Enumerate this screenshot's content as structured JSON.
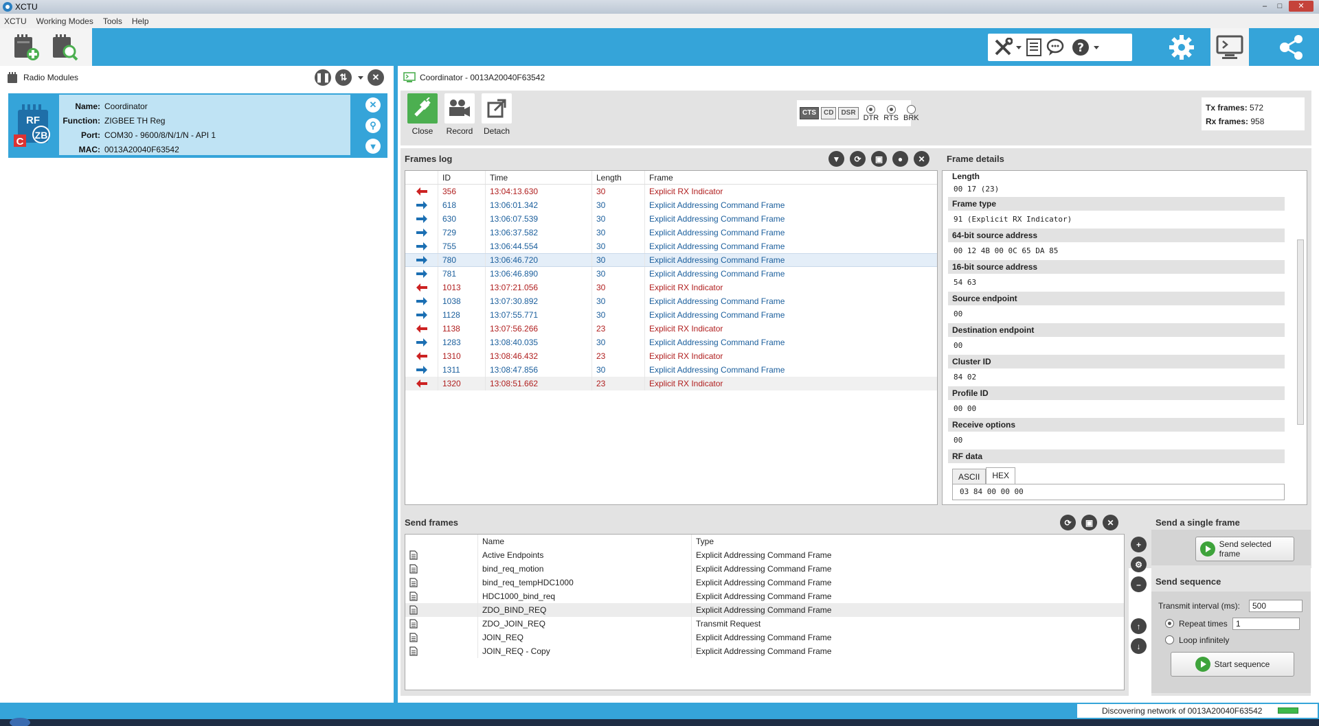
{
  "window": {
    "title": "XCTU"
  },
  "menu": [
    "XCTU",
    "Working Modes",
    "Tools",
    "Help"
  ],
  "left_panel": {
    "title": "Radio Modules",
    "module": {
      "name_label": "Name:",
      "name": "Coordinator",
      "function_label": "Function:",
      "function": "ZIGBEE TH Reg",
      "port_label": "Port:",
      "port": "COM30 - 9600/8/N/1/N - API 1",
      "mac_label": "MAC:",
      "mac": "0013A20040F63542",
      "icon_text_top": "RF",
      "icon_text_zb": "ZB",
      "icon_text_c": "C"
    }
  },
  "console": {
    "title": "Coordinator - 0013A20040F63542",
    "buttons": {
      "close": "Close",
      "record": "Record",
      "detach": "Detach"
    },
    "lines": {
      "cts": "CTS",
      "cd": "CD",
      "dsr": "DSR",
      "dtr": "DTR",
      "rts": "RTS",
      "brk": "BRK"
    },
    "counters": {
      "tx_label": "Tx frames:",
      "tx": "572",
      "rx_label": "Rx frames:",
      "rx": "958"
    }
  },
  "frames_log": {
    "title": "Frames log",
    "details_title": "Frame details",
    "columns": [
      "ID",
      "Time",
      "Length",
      "Frame"
    ],
    "rows": [
      {
        "dir": "rx",
        "id": "356",
        "time": "13:04:13.630",
        "length": "30",
        "frame": "Explicit RX Indicator"
      },
      {
        "dir": "tx",
        "id": "618",
        "time": "13:06:01.342",
        "length": "30",
        "frame": "Explicit Addressing Command Frame"
      },
      {
        "dir": "tx",
        "id": "630",
        "time": "13:06:07.539",
        "length": "30",
        "frame": "Explicit Addressing Command Frame"
      },
      {
        "dir": "tx",
        "id": "729",
        "time": "13:06:37.582",
        "length": "30",
        "frame": "Explicit Addressing Command Frame"
      },
      {
        "dir": "tx",
        "id": "755",
        "time": "13:06:44.554",
        "length": "30",
        "frame": "Explicit Addressing Command Frame"
      },
      {
        "dir": "tx",
        "id": "780",
        "time": "13:06:46.720",
        "length": "30",
        "frame": "Explicit Addressing Command Frame"
      },
      {
        "dir": "tx",
        "id": "781",
        "time": "13:06:46.890",
        "length": "30",
        "frame": "Explicit Addressing Command Frame"
      },
      {
        "dir": "rx",
        "id": "1013",
        "time": "13:07:21.056",
        "length": "30",
        "frame": "Explicit RX Indicator"
      },
      {
        "dir": "tx",
        "id": "1038",
        "time": "13:07:30.892",
        "length": "30",
        "frame": "Explicit Addressing Command Frame"
      },
      {
        "dir": "tx",
        "id": "1128",
        "time": "13:07:55.771",
        "length": "30",
        "frame": "Explicit Addressing Command Frame"
      },
      {
        "dir": "rx",
        "id": "1138",
        "time": "13:07:56.266",
        "length": "23",
        "frame": "Explicit RX Indicator"
      },
      {
        "dir": "tx",
        "id": "1283",
        "time": "13:08:40.035",
        "length": "30",
        "frame": "Explicit Addressing Command Frame"
      },
      {
        "dir": "rx",
        "id": "1310",
        "time": "13:08:46.432",
        "length": "23",
        "frame": "Explicit RX Indicator"
      },
      {
        "dir": "tx",
        "id": "1311",
        "time": "13:08:47.856",
        "length": "30",
        "frame": "Explicit Addressing Command Frame"
      },
      {
        "dir": "rx",
        "id": "1320",
        "time": "13:08:51.662",
        "length": "23",
        "frame": "Explicit RX Indicator"
      }
    ]
  },
  "frame_details": {
    "length_label": "Length",
    "length_value": "00 17 (23)",
    "fields": [
      {
        "label": "Frame type",
        "value": "91 (Explicit RX Indicator)"
      },
      {
        "label": "64-bit source address",
        "value": "00 12 4B 00 0C 65 DA 85"
      },
      {
        "label": "16-bit source address",
        "value": "54 63"
      },
      {
        "label": "Source endpoint",
        "value": "00"
      },
      {
        "label": "Destination endpoint",
        "value": "00"
      },
      {
        "label": "Cluster ID",
        "value": "84 02"
      },
      {
        "label": "Profile ID",
        "value": "00 00"
      },
      {
        "label": "Receive options",
        "value": "00"
      }
    ],
    "rf_label": "RF data",
    "tabs": [
      "ASCII",
      "HEX"
    ],
    "rf_hex": "03 84 00 00 00"
  },
  "send_frames": {
    "title": "Send frames",
    "columns": [
      "Name",
      "Type"
    ],
    "rows": [
      {
        "name": "Active Endpoints",
        "type": "Explicit Addressing Command Frame"
      },
      {
        "name": "bind_req_motion",
        "type": "Explicit Addressing Command Frame"
      },
      {
        "name": "bind_req_tempHDC1000",
        "type": "Explicit Addressing Command Frame"
      },
      {
        "name": "HDC1000_bind_req",
        "type": "Explicit Addressing Command Frame"
      },
      {
        "name": "ZDO_BIND_REQ",
        "type": "Explicit Addressing Command Frame"
      },
      {
        "name": "ZDO_JOIN_REQ",
        "type": "Transmit Request"
      },
      {
        "name": "JOIN_REQ",
        "type": "Explicit Addressing Command Frame"
      },
      {
        "name": "JOIN_REQ - Copy",
        "type": "Explicit Addressing Command Frame"
      }
    ]
  },
  "single_frame": {
    "title": "Send a single frame",
    "send_button": "Send selected frame",
    "sequence_title": "Send sequence",
    "interval_label": "Transmit interval (ms):",
    "interval_value": "500",
    "repeat_label": "Repeat times",
    "repeat_value": "1",
    "loop_label": "Loop infinitely",
    "start_button": "Start sequence"
  },
  "status": {
    "message": "Discovering network of 0013A20040F63542"
  },
  "colors": {
    "accent": "#35a4d9",
    "rx": "#b01e1e",
    "tx": "#1a5e9c",
    "ok": "#3ea33b"
  }
}
